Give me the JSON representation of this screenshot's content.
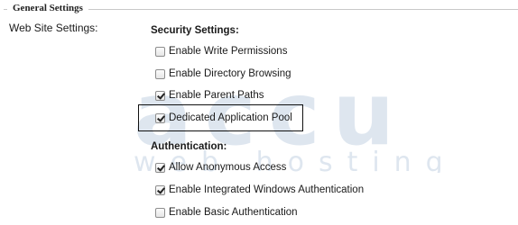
{
  "legend": "General Settings",
  "row_label": "Web Site Settings:",
  "security": {
    "title": "Security Settings:",
    "options": [
      {
        "label": "Enable Write Permissions",
        "checked": false
      },
      {
        "label": "Enable Directory Browsing",
        "checked": false
      },
      {
        "label": "Enable Parent Paths",
        "checked": true
      },
      {
        "label": "Dedicated Application Pool",
        "checked": true
      }
    ]
  },
  "authentication": {
    "title": "Authentication:",
    "options": [
      {
        "label": "Allow Anonymous Access",
        "checked": true
      },
      {
        "label": "Enable Integrated Windows Authentication",
        "checked": true
      },
      {
        "label": "Enable Basic Authentication",
        "checked": false
      }
    ]
  },
  "watermark": {
    "brand": "accu",
    "sub": "web hosting",
    "color": "#c9d6e6"
  }
}
